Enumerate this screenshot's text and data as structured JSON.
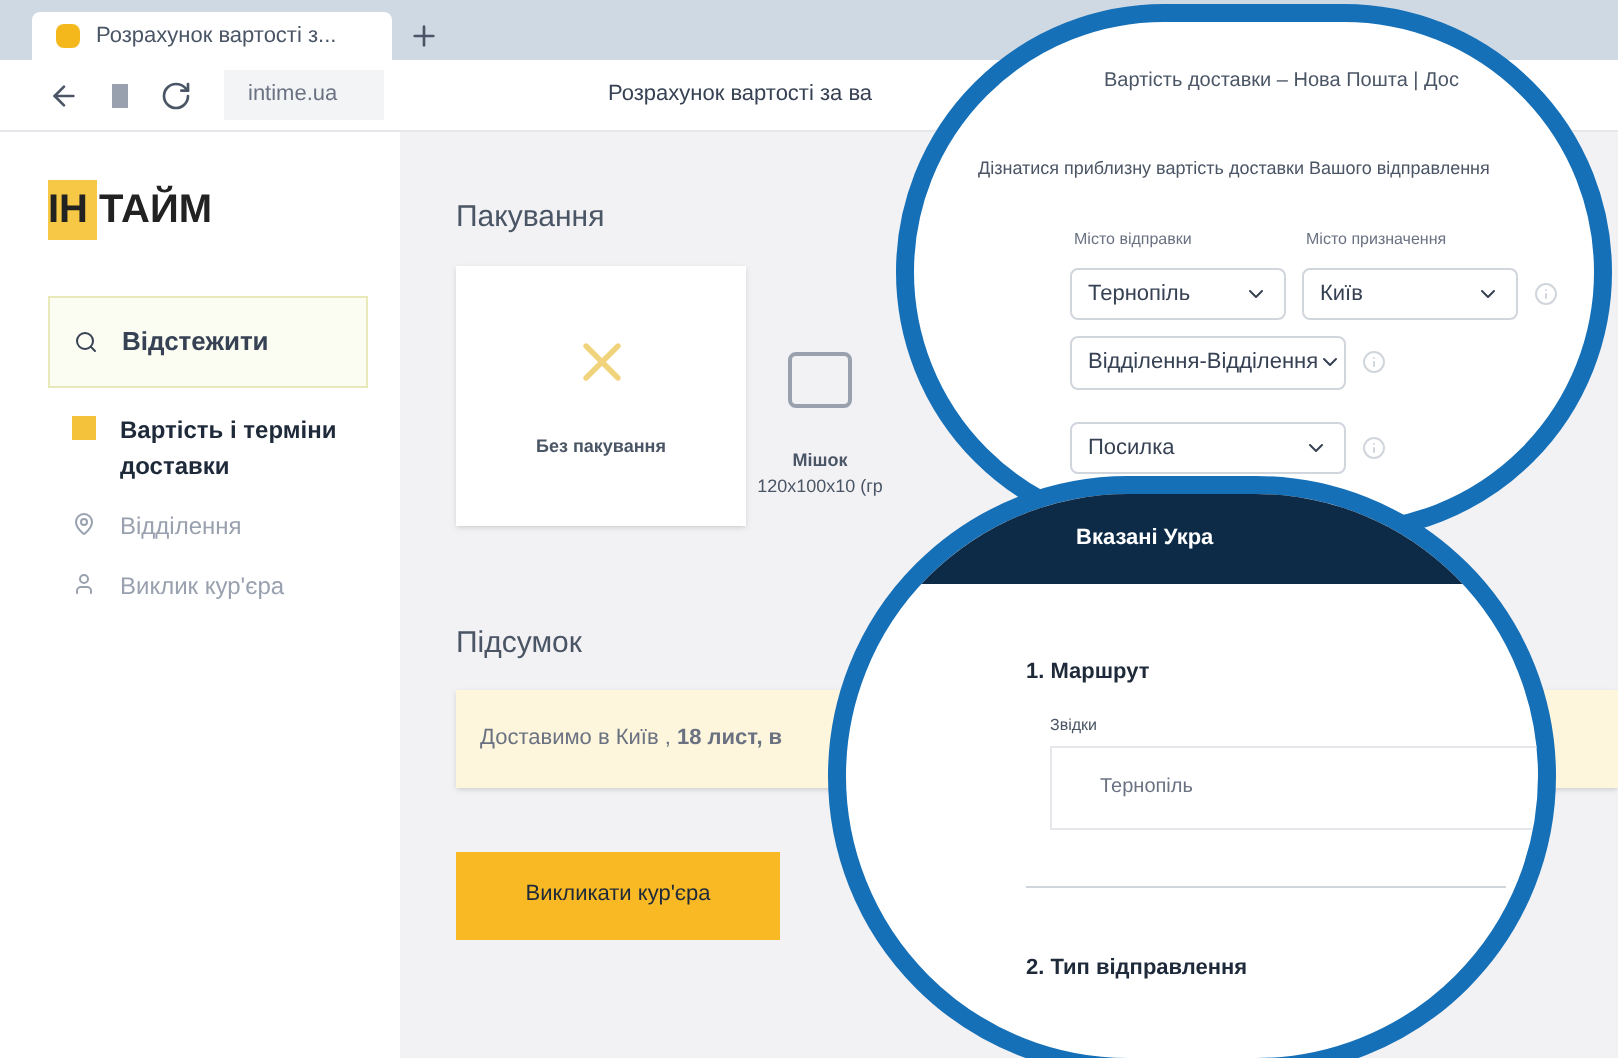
{
  "browser": {
    "tab_title": "Розрахунок вартості з...",
    "address": "intime.ua",
    "page_title": "Розрахунок вартості за ва"
  },
  "sidebar": {
    "logo": "ІН ТАЙМ",
    "track_button": "Відстежити",
    "items": [
      {
        "label": "Вартість і терміни доставки",
        "selected": true
      },
      {
        "label": "Відділення",
        "selected": false
      },
      {
        "label": "Виклик кур'єра",
        "selected": false
      }
    ]
  },
  "packaging": {
    "title": "Пакування",
    "options": [
      {
        "label": "Без пакування",
        "kind": "none",
        "selected": true
      },
      {
        "label": "Мішок",
        "detail": "120х100х10 (гр",
        "kind": "bag",
        "selected": false
      }
    ]
  },
  "summary": {
    "title": "Підсумок",
    "text": "Доставимо в Київ , **18 лист, в**"
  },
  "call_courier_button": "Викликати кур'єра",
  "magnifier_top": {
    "tab_title": "Вартість доставки – Нова Пошта | Дос",
    "subtitle": "Дізнатися приблизну вартість доставки Вашого відправлення",
    "from_label": "Місто відправки",
    "to_label": "Місто призначення",
    "selects": [
      "Тернопіль",
      "Київ",
      "Відділення-Відділення",
      "Посилка"
    ]
  },
  "magnifier_bottom": {
    "header": "Вказані Укра",
    "section_1": "1. Маршрут",
    "from_label": "Звідки",
    "from_value": "Тернопіль",
    "section_2": "2. Тип відправлення"
  }
}
